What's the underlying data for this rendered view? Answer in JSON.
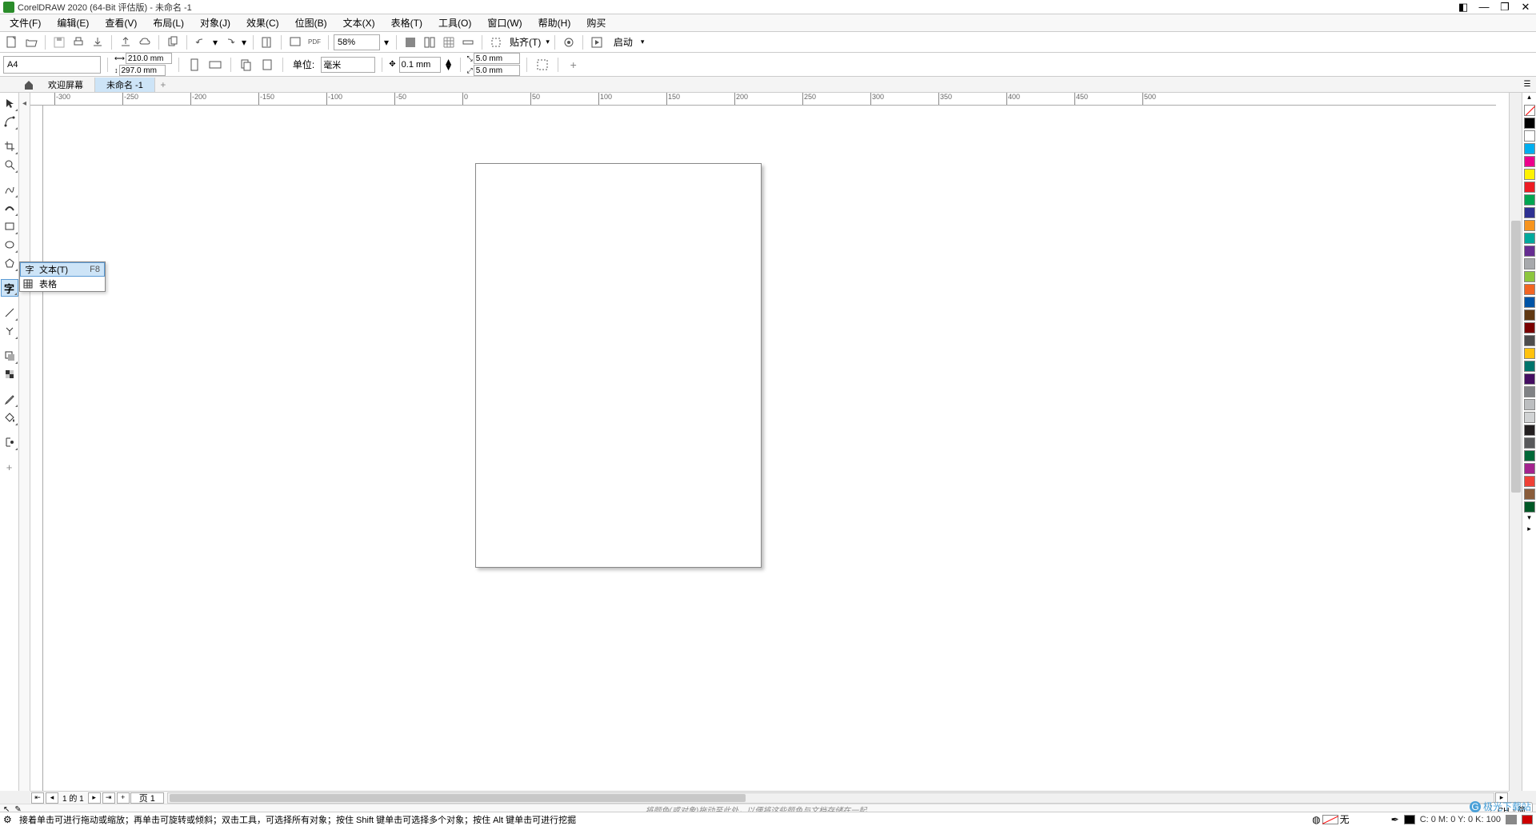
{
  "titlebar": {
    "title": "CorelDRAW 2020 (64-Bit 评估版) - 未命名 -1"
  },
  "menubar": {
    "items": [
      "文件(F)",
      "编辑(E)",
      "查看(V)",
      "布局(L)",
      "对象(J)",
      "效果(C)",
      "位图(B)",
      "文本(X)",
      "表格(T)",
      "工具(O)",
      "窗口(W)",
      "帮助(H)",
      "购买"
    ]
  },
  "toolbar1": {
    "zoom": "58%",
    "snap": "贴齐(T)",
    "launch": "启动"
  },
  "propertybar": {
    "papersize": "A4",
    "width": "210.0 mm",
    "height": "297.0 mm",
    "unit_label": "单位:",
    "unit": "毫米",
    "nudge": "0.1 mm",
    "dup_x": "5.0 mm",
    "dup_y": "5.0 mm"
  },
  "tabs": {
    "welcome": "欢迎屏幕",
    "doc": "未命名 -1"
  },
  "ruler_h": [
    "-300",
    "-250",
    "-200",
    "-150",
    "-100",
    "-50",
    "0",
    "50",
    "100",
    "150",
    "200",
    "250",
    "300",
    "350",
    "400",
    "450",
    "500"
  ],
  "flyout": {
    "text_label": "文本(T)",
    "text_key": "F8",
    "table_label": "表格"
  },
  "page_nav": {
    "info": "1 的 1",
    "page_label": "页 1"
  },
  "hint": {
    "text": "将颜色(或对象)拖动至此处，以便将这些颜色与文档存储在一起",
    "ime": "CH ♪ 简"
  },
  "watermark": "极光下载站",
  "statusbar": {
    "help": "接着单击可进行拖动或缩放；再单击可旋转或倾斜；双击工具，可选择所有对象；按住 Shift 键单击可选择多个对象；按住 Alt 键单击可进行挖掘",
    "fill_none": "无",
    "coords": "C:  0 M:  0 Y:  0 K: 100"
  },
  "colors": [
    "#000000",
    "#ffffff",
    "#00aeef",
    "#ec008c",
    "#fff200",
    "#ed1c24",
    "#00a651",
    "#2e3192",
    "#f7941d",
    "#00a99d",
    "#662d91",
    "#a7a9ac",
    "#8dc63f",
    "#f26522",
    "#0054a6",
    "#603913",
    "#790000",
    "#4d4d4d",
    "#ffc20e",
    "#00746b",
    "#440e62",
    "#808285",
    "#bcbec0",
    "#d1d3d4",
    "#231f20",
    "#58595b",
    "#006838",
    "#a3238e",
    "#ef4136",
    "#8a5d3b",
    "#005826"
  ]
}
